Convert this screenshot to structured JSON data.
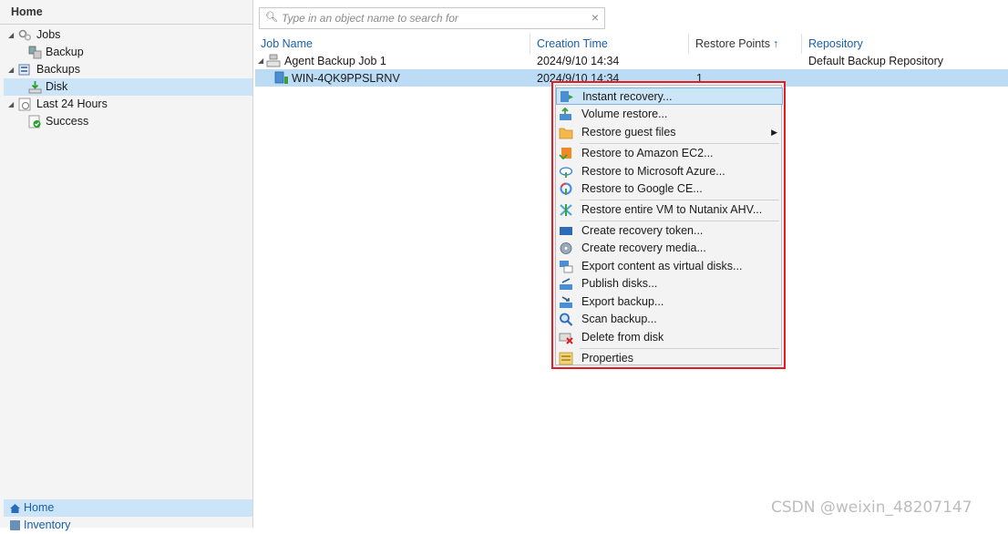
{
  "nav": {
    "header": "Home",
    "tree": [
      {
        "label": "Jobs"
      },
      {
        "label": "Backup"
      },
      {
        "label": "Backups"
      },
      {
        "label": "Disk"
      },
      {
        "label": "Last 24 Hours"
      },
      {
        "label": "Success"
      }
    ],
    "bottom": [
      {
        "label": "Home"
      },
      {
        "label": "Inventory"
      }
    ]
  },
  "search": {
    "placeholder": "Type in an object name to search for"
  },
  "table": {
    "columns": [
      "Job Name",
      "Creation Time",
      "Restore Points",
      "Repository"
    ],
    "rows": [
      {
        "name": "Agent Backup Job 1",
        "time": "2024/9/10 14:34",
        "points": "",
        "repo": "Default Backup Repository"
      },
      {
        "name": "WIN-4QK9PPSLRNV",
        "time": "2024/9/10 14:34",
        "points": "1",
        "repo": ""
      }
    ]
  },
  "context_menu": {
    "items": [
      {
        "label": "Instant recovery...",
        "icon": "instant-recovery-icon"
      },
      {
        "label": "Volume restore...",
        "icon": "volume-restore-icon"
      },
      {
        "label": "Restore guest files",
        "icon": "folder-icon",
        "submenu": true
      },
      {
        "label": "Restore to Amazon EC2...",
        "icon": "amazon-icon"
      },
      {
        "label": "Restore to Microsoft Azure...",
        "icon": "azure-cloud-icon"
      },
      {
        "label": "Restore to Google CE...",
        "icon": "google-cloud-icon"
      },
      {
        "label": "Restore entire VM to Nutanix AHV...",
        "icon": "nutanix-icon"
      },
      {
        "label": "Create recovery token...",
        "icon": "token-icon"
      },
      {
        "label": "Create recovery media...",
        "icon": "media-icon"
      },
      {
        "label": "Export content as virtual disks...",
        "icon": "export-disk-icon"
      },
      {
        "label": "Publish disks...",
        "icon": "publish-disk-icon"
      },
      {
        "label": "Export backup...",
        "icon": "export-backup-icon"
      },
      {
        "label": "Scan backup...",
        "icon": "scan-icon"
      },
      {
        "label": "Delete from disk",
        "icon": "delete-icon"
      },
      {
        "label": "Properties",
        "icon": "properties-icon"
      }
    ]
  },
  "watermark": "CSDN @weixin_48207147",
  "colors": {
    "accent": "#1a5fa8",
    "selection": "#cce4f7",
    "menu_highlight_border": "#e41c23"
  }
}
